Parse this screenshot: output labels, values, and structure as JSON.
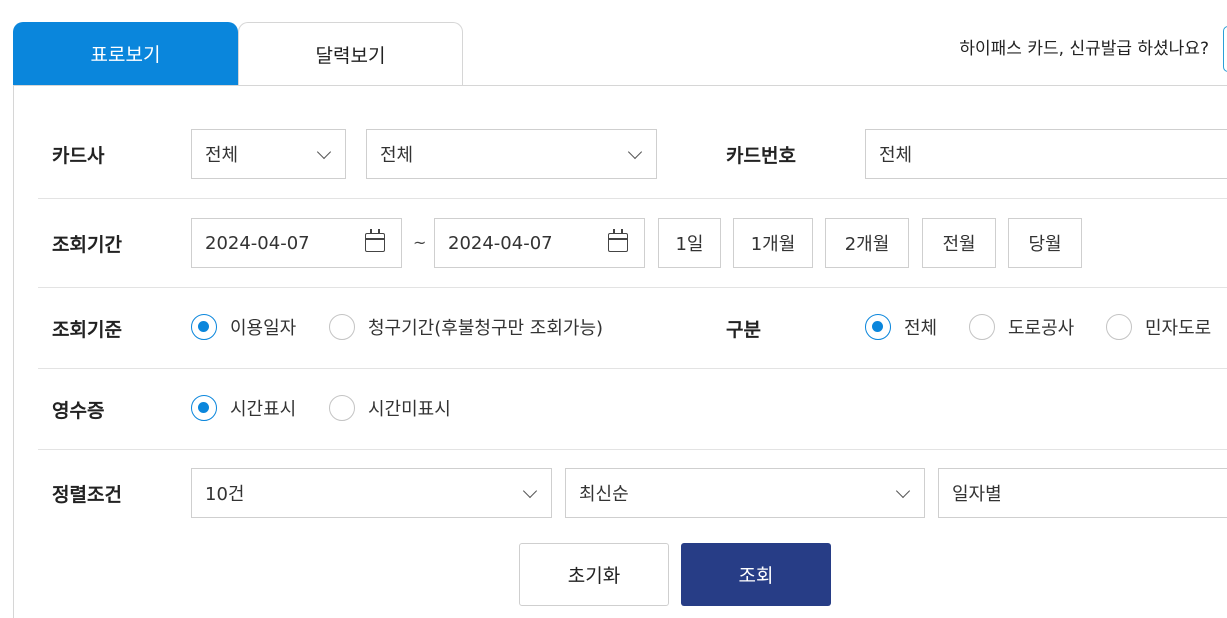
{
  "tabs": {
    "table_view": "표로보기",
    "calendar_view": "달력보기"
  },
  "notice": {
    "text": "하이패스 카드, 신규발급 하셨나요?"
  },
  "card_company": {
    "label": "카드사",
    "select1_value": "전체",
    "select2_value": "전체"
  },
  "card_number": {
    "label": "카드번호",
    "value": "전체"
  },
  "period": {
    "label": "조회기간",
    "start_date": "2024-04-07",
    "separator": "~",
    "end_date": "2024-04-07",
    "quick_buttons": [
      "1일",
      "1개월",
      "2개월",
      "전월",
      "당월"
    ]
  },
  "criteria": {
    "label": "조회기준",
    "options": [
      "이용일자",
      "청구기간(후불청구만 조회가능)"
    ],
    "selected": "이용일자"
  },
  "category": {
    "label": "구분",
    "options": [
      "전체",
      "도로공사",
      "민자도로"
    ],
    "selected": "전체"
  },
  "receipt": {
    "label": "영수증",
    "options": [
      "시간표시",
      "시간미표시"
    ],
    "selected": "시간표시"
  },
  "sort": {
    "label": "정렬조건",
    "count_value": "10건",
    "order_value": "최신순",
    "group_value": "일자별"
  },
  "actions": {
    "reset": "초기화",
    "search": "조회"
  },
  "colors": {
    "accent": "#0a86dc",
    "primary_button": "#273d86",
    "border": "#cfcfcf"
  }
}
